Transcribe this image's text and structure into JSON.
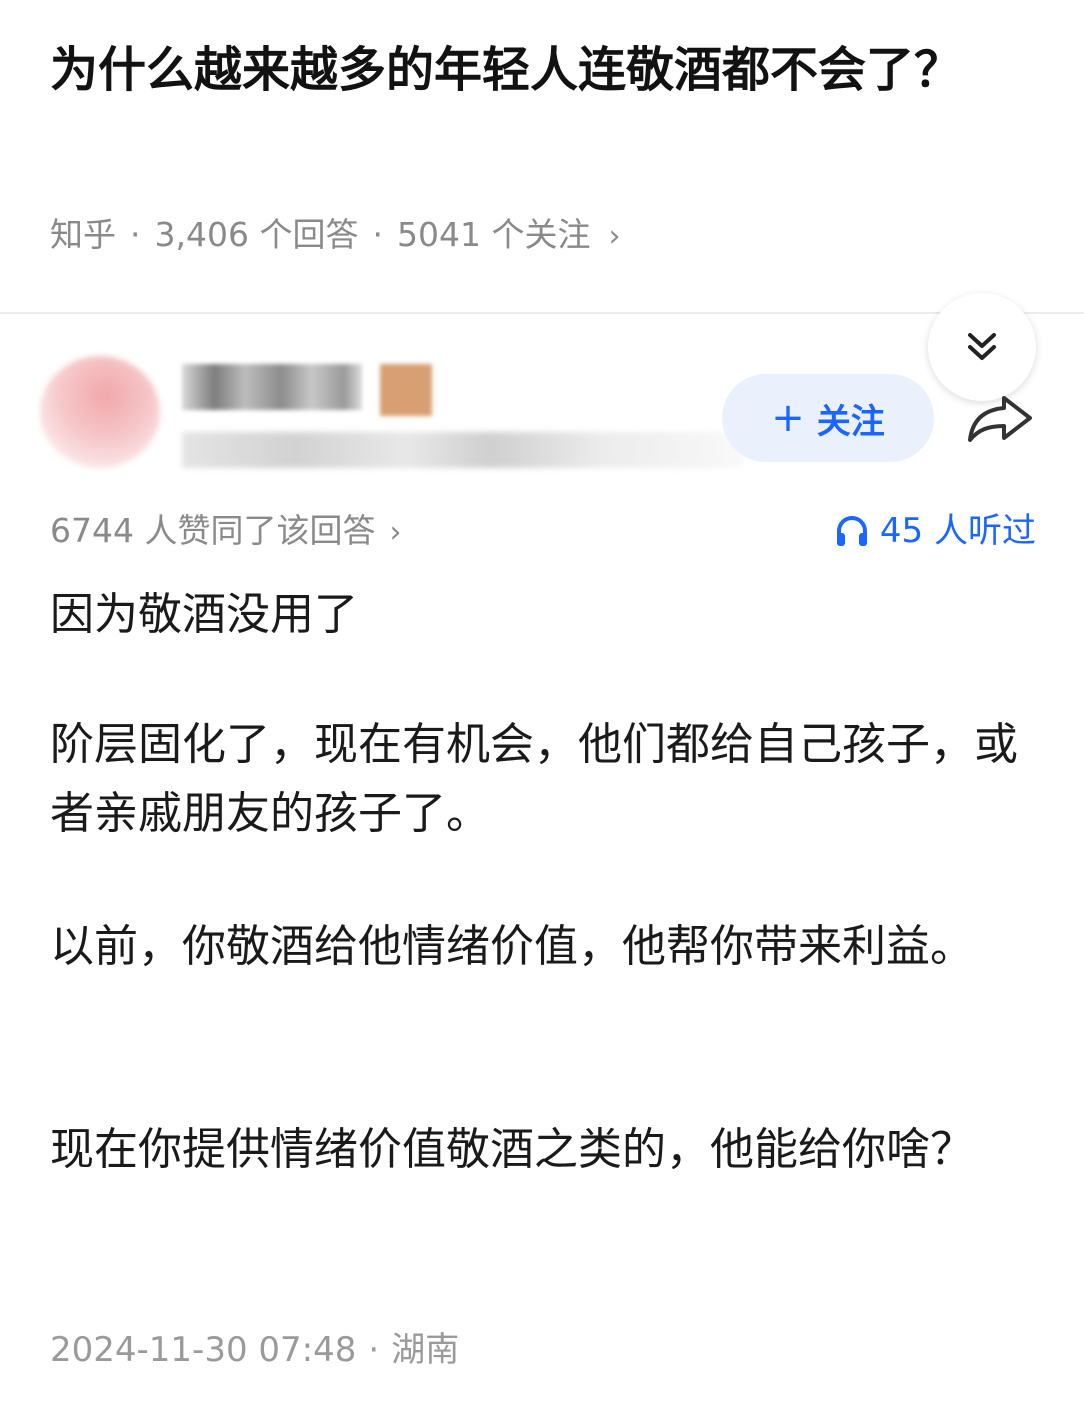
{
  "question": {
    "title": "为什么越来越多的年轻人连敬酒都不会了？",
    "source": "知乎",
    "answers": "3,406 个回答",
    "followers": "5041 个关注"
  },
  "author": {
    "follow_label": "关注"
  },
  "answer": {
    "upvotes": "6744 人赞同了该回答",
    "listened": "45 人听过",
    "paragraphs": [
      "因为敬酒没用了",
      "阶层固化了，现在有机会，他们都给自己孩子，或者亲戚朋友的孩子了。",
      "以前，你敬酒给他情绪价值，他帮你带来利益。",
      "现在你提供情绪价值敬酒之类的，他能给你啥？"
    ],
    "timestamp": "2024-11-30 07:48",
    "location": "湖南"
  },
  "colors": {
    "accent": "#1a66ff",
    "follow_bg": "#eaf1fd",
    "meta_text": "#8a8a8a"
  },
  "icons": [
    "chevron-double-down-icon",
    "plus-icon",
    "share-arrow-icon",
    "headphones-icon",
    "chevron-right-icon"
  ]
}
